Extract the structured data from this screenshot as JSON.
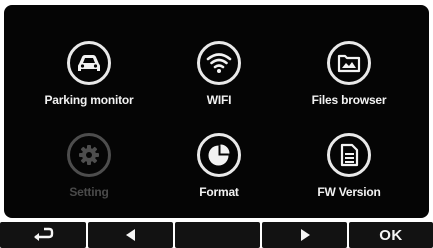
{
  "menu": {
    "items": [
      {
        "label": "Parking monitor",
        "icon": "car-icon",
        "enabled": true
      },
      {
        "label": "WIFI",
        "icon": "wifi-icon",
        "enabled": true
      },
      {
        "label": "Files browser",
        "icon": "folder-image-icon",
        "enabled": true
      },
      {
        "label": "Setting",
        "icon": "gear-icon",
        "enabled": false
      },
      {
        "label": "Format",
        "icon": "pie-chart-icon",
        "enabled": true
      },
      {
        "label": "FW Version",
        "icon": "document-icon",
        "enabled": true
      }
    ]
  },
  "bottom_bar": {
    "buttons": [
      {
        "icon": "back-return-icon"
      },
      {
        "icon": "arrow-left-icon"
      },
      {
        "icon": "blank"
      },
      {
        "icon": "arrow-right-icon"
      },
      {
        "label": "OK"
      }
    ]
  },
  "colors": {
    "panel_bg": "#050505",
    "text": "#f2f2f2",
    "disabled": "#4a4a4a"
  }
}
